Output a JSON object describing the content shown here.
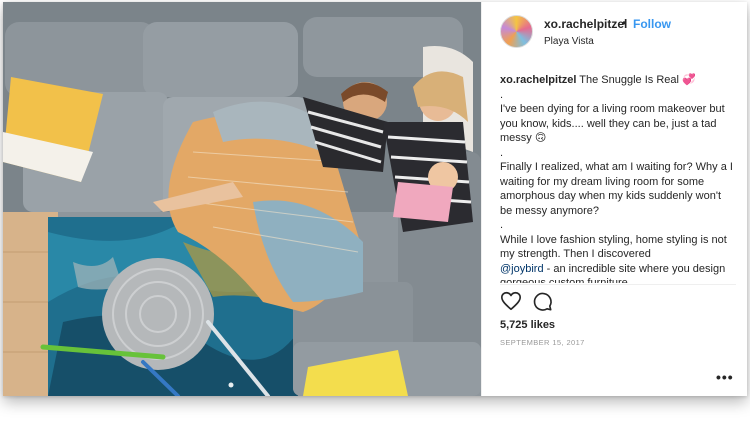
{
  "post": {
    "username": "xo.rachelpitzel",
    "separator": "•",
    "follow_label": "Follow",
    "location": "Playa Vista",
    "caption_author": "xo.rachelpitzel",
    "caption_title": " The Snuggle Is Real ",
    "caption_title_emoji": "💞",
    "caption_lines": [
      ".",
      "I've been dying for a living room makeover but you know, kids.... well they can be, just a tad messy 🙃",
      ".",
      "Finally I realized, what am I waiting for? Why a I waiting for my dream living room for some amorphous day when my kids suddenly won't be messy anymore?",
      ".",
      "While I love fashion styling, home styling is not my strength. Then I discovered"
    ],
    "mention": "@joybird",
    "mention_trailing": " - an incredible site where you design gorgeous custom furniture",
    "likes": "5,725 likes",
    "date": "SEPTEMBER 15, 2017",
    "more_label": "•••",
    "icons": {
      "like": "heart-icon",
      "comment": "comment-icon",
      "more": "more-options-icon"
    }
  },
  "colors": {
    "link": "#3897f0",
    "text": "#262626",
    "muted": "#999999"
  }
}
